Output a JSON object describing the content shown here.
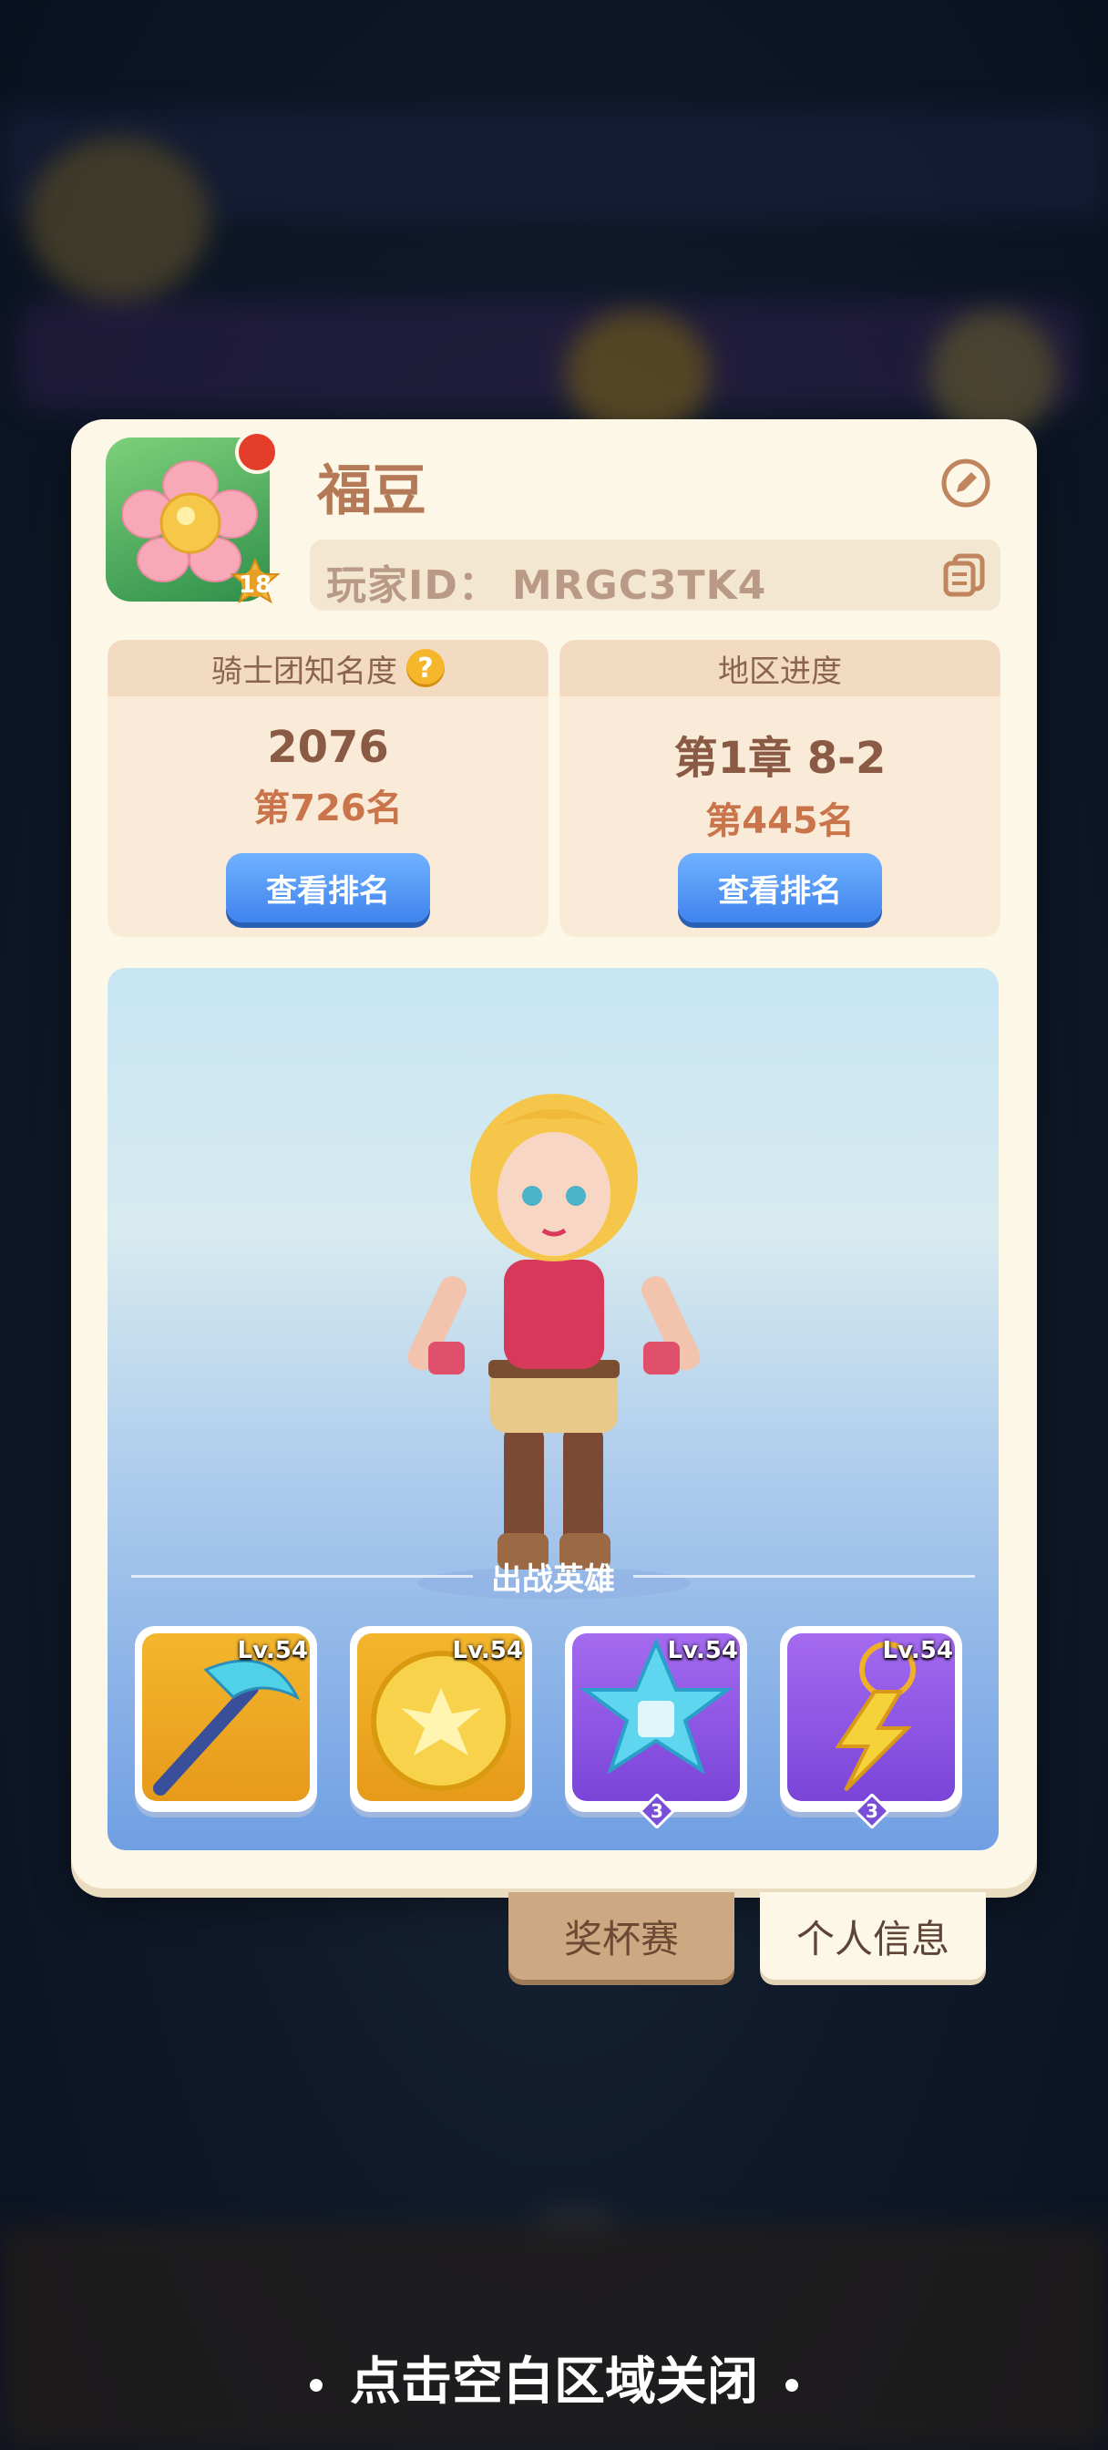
{
  "player": {
    "name": "福豆",
    "id_label": "玩家ID：",
    "id_value": "MRGC3TK4",
    "level": "18"
  },
  "stats": {
    "fame": {
      "title": "骑士团知名度",
      "value": "2076",
      "rank": "第726名",
      "button": "查看排名"
    },
    "region": {
      "title": "地区进度",
      "value": "第1章 8-2",
      "rank": "第445名",
      "button": "查看排名"
    }
  },
  "battle": {
    "title": "出战英雄",
    "heroes": [
      {
        "level": "Lv.54",
        "icon": "ice-scythe-icon"
      },
      {
        "level": "Lv.54",
        "icon": "gold-orb-icon"
      },
      {
        "level": "Lv.54",
        "icon": "ice-star-icon",
        "stars": "3"
      },
      {
        "level": "Lv.54",
        "icon": "lightning-amulet-icon",
        "stars": "3"
      }
    ]
  },
  "tabs": {
    "trophy": "奖杯赛",
    "info": "个人信息"
  },
  "close_hint": "点击空白区域关闭",
  "colors": {
    "panel": "#fdf7e8",
    "accent_name": "#b47a58",
    "button_blue": "#3f83ee",
    "rank_orange": "#c9744a"
  }
}
